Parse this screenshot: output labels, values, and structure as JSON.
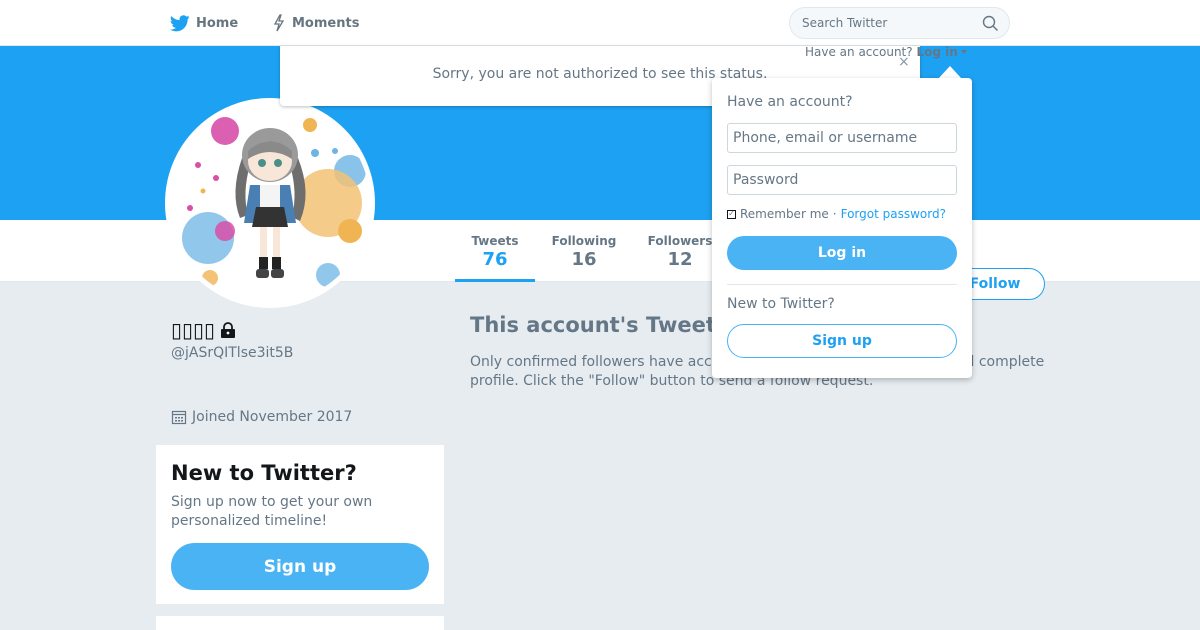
{
  "nav": {
    "home_label": "Home",
    "moments_label": "Moments",
    "search_placeholder": "Search Twitter"
  },
  "alert": {
    "message": "Sorry, you are not authorized to see this status.",
    "close_symbol": "×"
  },
  "login_hint": {
    "prefix": "Have an account?",
    "link": "Log in"
  },
  "dropdown": {
    "title": "Have an account?",
    "username_placeholder": "Phone, email or username",
    "password_placeholder": "Password",
    "remember_label": "Remember me",
    "separator": "·",
    "forgot_label": "Forgot password?",
    "login_button": "Log in",
    "new_label": "New to Twitter?",
    "signup_button": "Sign up"
  },
  "stats": [
    {
      "label": "Tweets",
      "value": "76"
    },
    {
      "label": "Following",
      "value": "16"
    },
    {
      "label": "Followers",
      "value": "12"
    }
  ],
  "follow_button": "Follow",
  "profile": {
    "name": "▯▯▯▯",
    "handle": "@jASrQITlse3it5B",
    "joined": "Joined November 2017"
  },
  "protected": {
    "title": "This account's Tweets are protected.",
    "text": "Only confirmed followers have access to @jASrQITlse3it5B's Tweets and complete profile. Click the \"Follow\" button to send a follow request."
  },
  "new_card": {
    "title": "New to Twitter?",
    "text": "Sign up now to get your own personalized timeline!",
    "button": "Sign up"
  },
  "colors": {
    "accent": "#1da1f2",
    "button": "#4ab3f4",
    "background": "#e6ecf0"
  }
}
